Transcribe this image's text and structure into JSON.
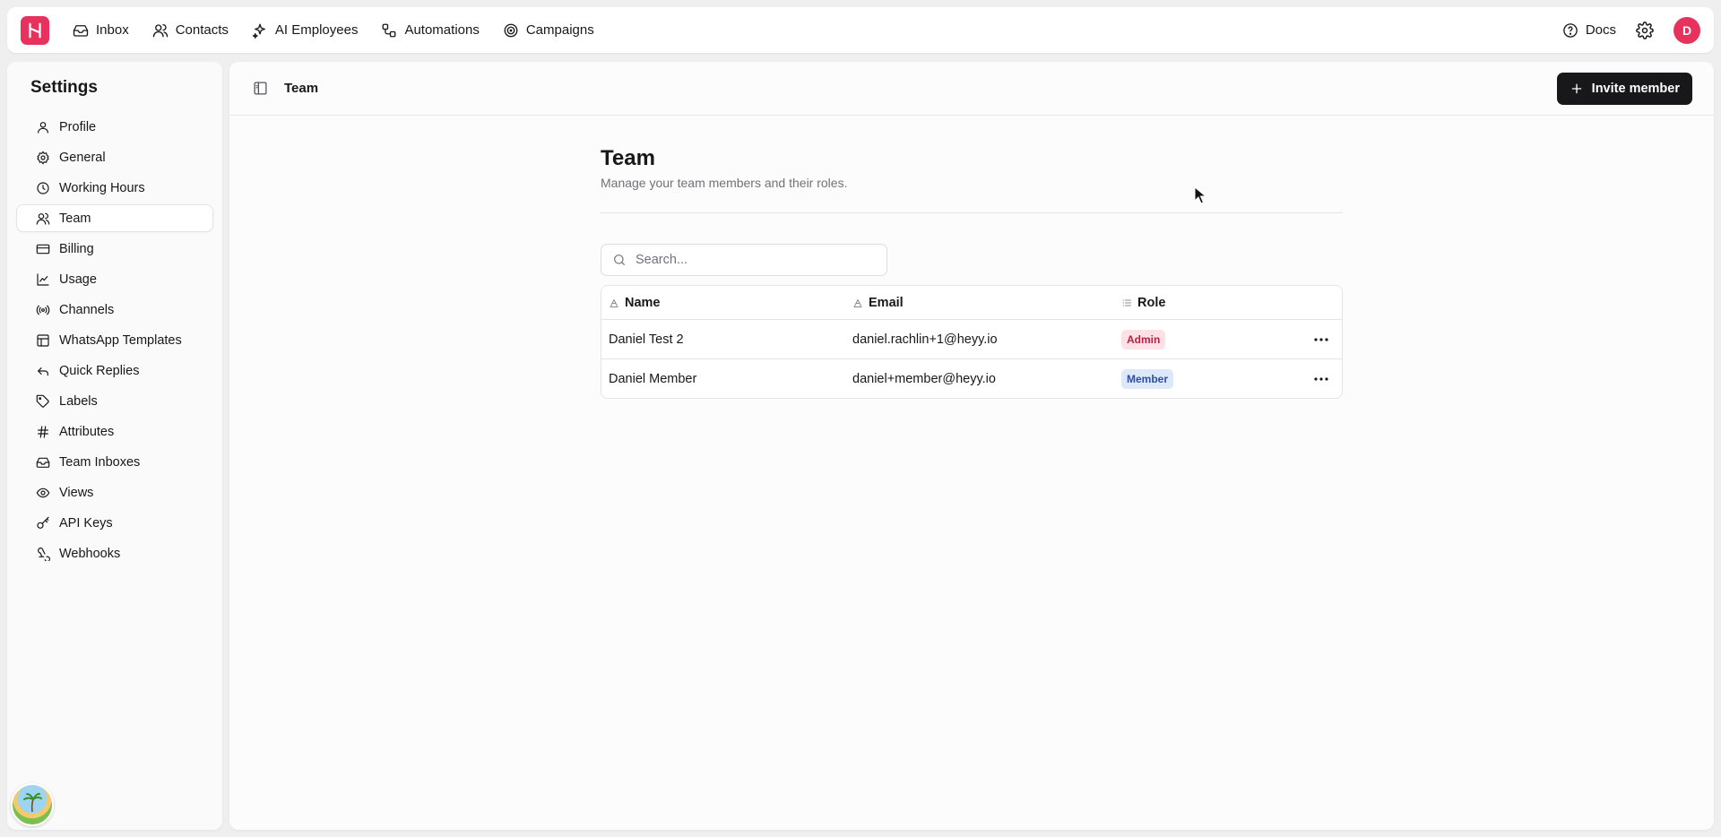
{
  "topnav": {
    "items": [
      {
        "label": "Inbox",
        "icon": "inbox-icon"
      },
      {
        "label": "Contacts",
        "icon": "users-icon"
      },
      {
        "label": "AI Employees",
        "icon": "sparkles-icon"
      },
      {
        "label": "Automations",
        "icon": "workflow-icon"
      },
      {
        "label": "Campaigns",
        "icon": "target-icon"
      }
    ],
    "docs_label": "Docs",
    "avatar_initial": "D",
    "brand_color": "#e8325e"
  },
  "sidebar": {
    "title": "Settings",
    "items": [
      {
        "label": "Profile",
        "icon": "user-icon"
      },
      {
        "label": "General",
        "icon": "gear-icon"
      },
      {
        "label": "Working Hours",
        "icon": "clock-icon"
      },
      {
        "label": "Team",
        "icon": "users-icon",
        "active": true
      },
      {
        "label": "Billing",
        "icon": "credit-card-icon"
      },
      {
        "label": "Usage",
        "icon": "chart-line-icon"
      },
      {
        "label": "Channels",
        "icon": "broadcast-icon"
      },
      {
        "label": "WhatsApp Templates",
        "icon": "template-icon"
      },
      {
        "label": "Quick Replies",
        "icon": "reply-icon"
      },
      {
        "label": "Labels",
        "icon": "tag-icon"
      },
      {
        "label": "Attributes",
        "icon": "hash-icon"
      },
      {
        "label": "Team Inboxes",
        "icon": "inbox-icon"
      },
      {
        "label": "Views",
        "icon": "eye-icon"
      },
      {
        "label": "API Keys",
        "icon": "key-icon"
      },
      {
        "label": "Webhooks",
        "icon": "webhook-icon"
      }
    ]
  },
  "header": {
    "breadcrumb": "Team",
    "invite_label": "Invite member"
  },
  "page": {
    "title": "Team",
    "subtitle": "Manage your team members and their roles.",
    "search_placeholder": "Search..."
  },
  "table": {
    "columns": [
      "Name",
      "Email",
      "Role"
    ],
    "rows": [
      {
        "name": "Daniel Test 2",
        "email": "daniel.rachlin+1@heyy.io",
        "role": "Admin"
      },
      {
        "name": "Daniel Member",
        "email": "daniel+member@heyy.io",
        "role": "Member"
      }
    ]
  }
}
